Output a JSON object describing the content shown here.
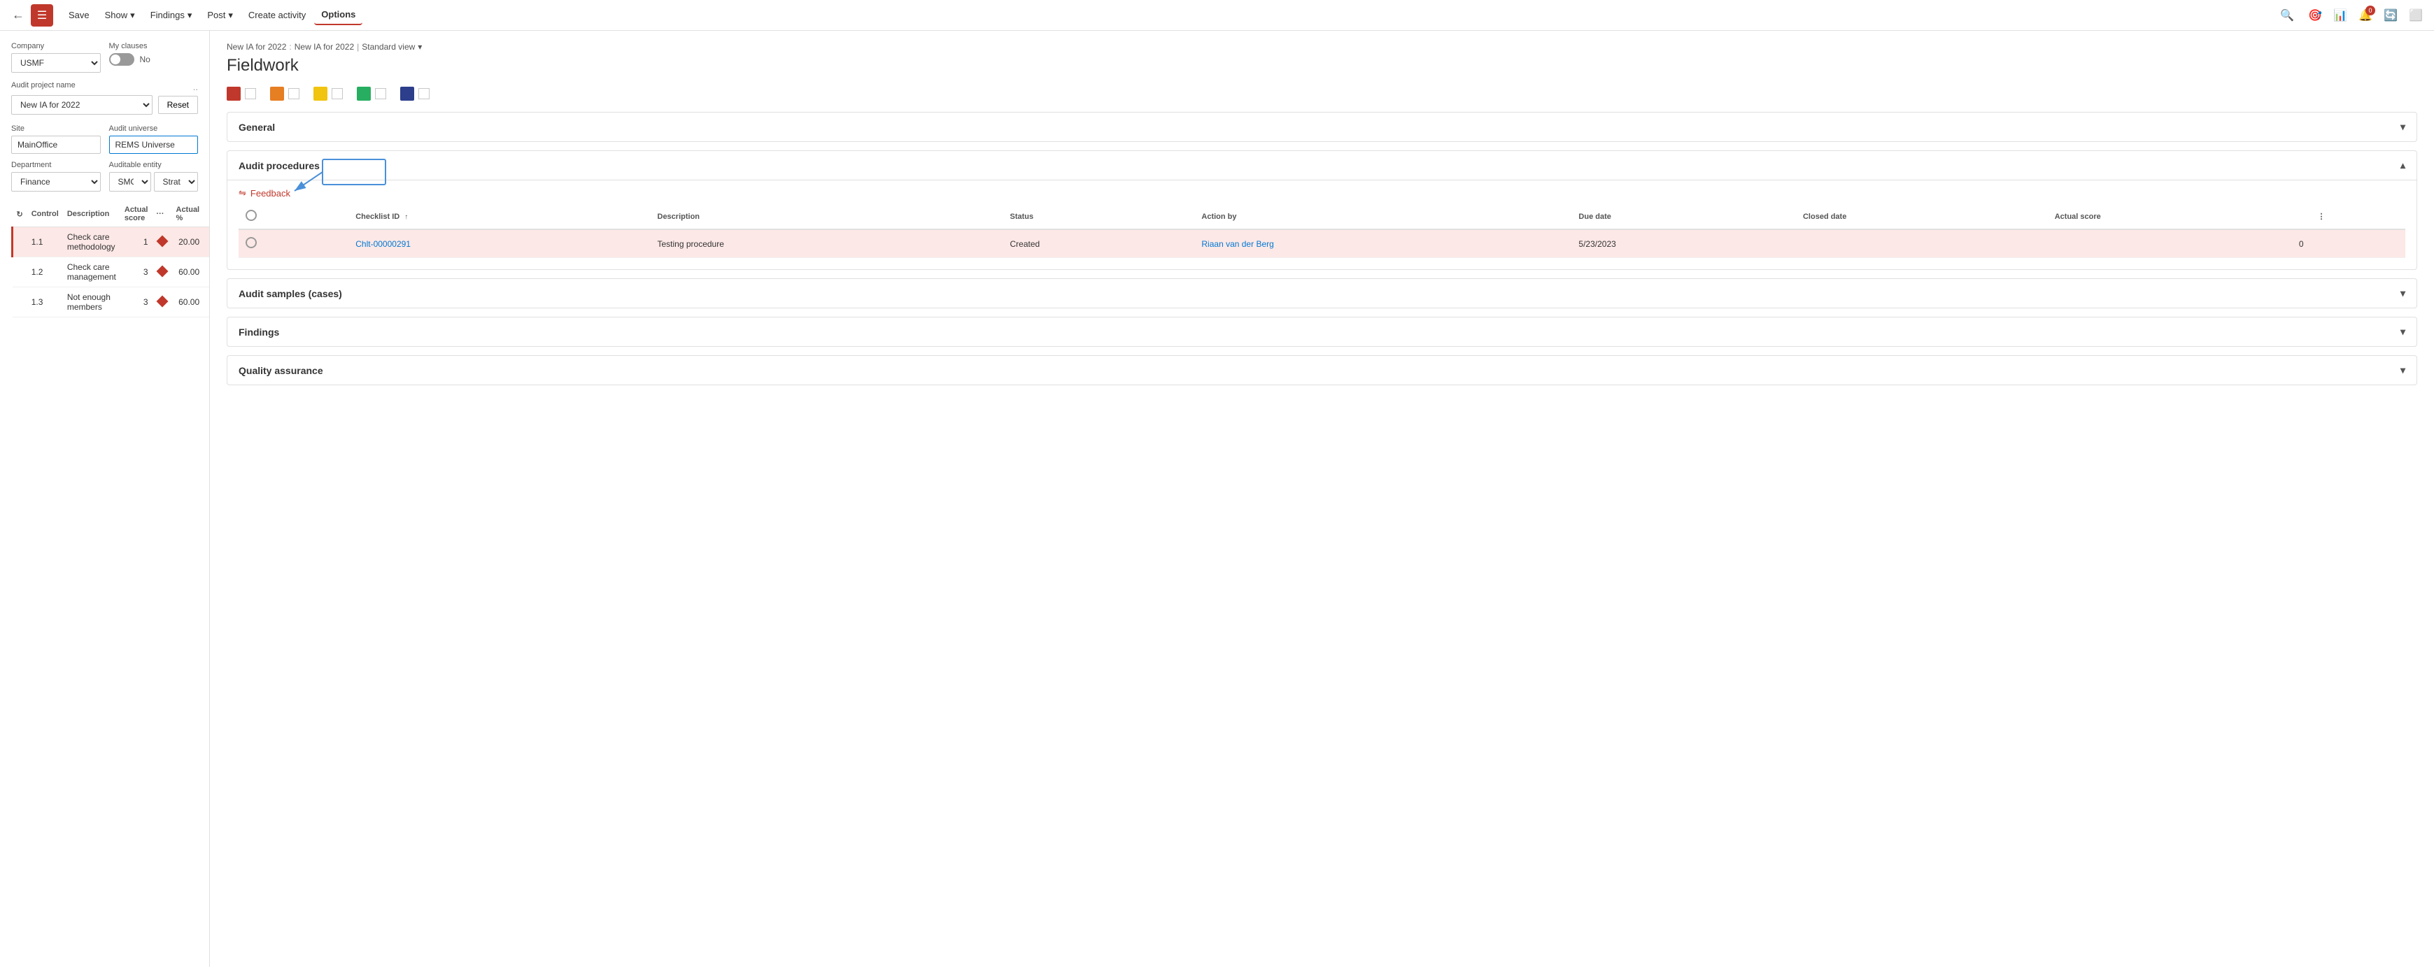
{
  "topbar": {
    "back_label": "←",
    "menu_icon": "☰",
    "save_label": "Save",
    "show_label": "Show",
    "findings_label": "Findings",
    "post_label": "Post",
    "create_activity_label": "Create activity",
    "options_label": "Options",
    "search_icon": "🔍",
    "icon1": "🎯",
    "icon2": "📊",
    "icon3_label": "0",
    "icon4": "🔄",
    "icon5": "⬜"
  },
  "left_panel": {
    "company_label": "Company",
    "company_value": "USMF",
    "my_clauses_label": "My clauses",
    "toggle_state": "No",
    "audit_project_label": "Audit project name",
    "audit_dots": "..",
    "audit_value": "New IA for 2022",
    "reset_label": "Reset",
    "site_label": "Site",
    "site_value": "MainOffice",
    "audit_universe_label": "Audit universe",
    "audit_universe_value": "REMS Universe",
    "department_label": "Department",
    "department_value": "Finance",
    "auditable_entity_label": "Auditable entity",
    "auditable_entity_value": "SMC",
    "auditable_entity_sub": "Strategic M...",
    "table": {
      "col_control": "Control",
      "col_description": "Description",
      "col_actual_score": "Actual score",
      "col_actual_pct": "Actual %",
      "rows": [
        {
          "control": "1.1",
          "description": "Check care methodology",
          "actual_score": "1",
          "actual_pct": "20.00",
          "selected": true
        },
        {
          "control": "1.2",
          "description": "Check care management",
          "actual_score": "3",
          "actual_pct": "60.00",
          "selected": false
        },
        {
          "control": "1.3",
          "description": "Not enough members",
          "actual_score": "3",
          "actual_pct": "60.00",
          "selected": false
        }
      ]
    }
  },
  "right_panel": {
    "breadcrumb_part1": "New IA for 2022",
    "breadcrumb_sep": ":",
    "breadcrumb_part2": "New IA for 2022",
    "breadcrumb_pipe": "|",
    "breadcrumb_view": "Standard view",
    "page_title": "Fieldwork",
    "colors": [
      {
        "color": "#c0382b",
        "id": "red"
      },
      {
        "color": "#e67e22",
        "id": "orange"
      },
      {
        "color": "#f1c40f",
        "id": "yellow"
      },
      {
        "color": "#27ae60",
        "id": "green"
      },
      {
        "color": "#2c3e8c",
        "id": "blue"
      }
    ],
    "sections": [
      {
        "id": "general",
        "label": "General",
        "expanded": false
      },
      {
        "id": "audit_procedures",
        "label": "Audit procedures",
        "expanded": true,
        "feedback_label": "Feedback",
        "table": {
          "col_checkbox": "",
          "col_checklist_id": "Checklist ID",
          "col_description": "Description",
          "col_status": "Status",
          "col_action_by": "Action by",
          "col_due_date": "Due date",
          "col_closed_date": "Closed date",
          "col_actual_score": "Actual score",
          "rows": [
            {
              "id": "Chlt-00000291",
              "description": "Testing procedure",
              "status": "Created",
              "action_by": "Riaan van der Berg",
              "due_date": "5/23/2023",
              "closed_date": "",
              "actual_score": "0",
              "selected": true
            }
          ]
        }
      },
      {
        "id": "audit_samples",
        "label": "Audit samples (cases)",
        "expanded": false
      },
      {
        "id": "findings",
        "label": "Findings",
        "expanded": false
      },
      {
        "id": "quality_assurance",
        "label": "Quality assurance",
        "expanded": false
      }
    ]
  }
}
